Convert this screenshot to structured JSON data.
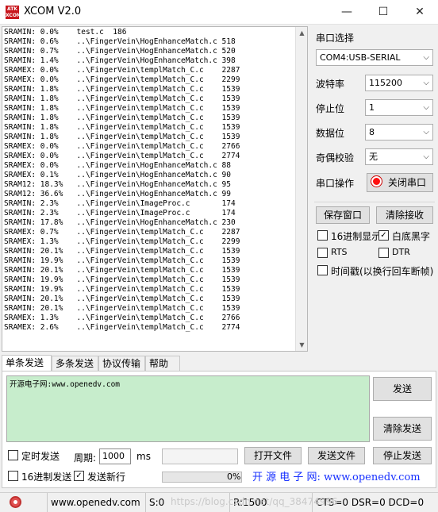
{
  "window": {
    "title": "XCOM V2.0",
    "logo_text": "ATK XCOM",
    "minimize": "—",
    "maximize": "☐",
    "close": "✕"
  },
  "console": {
    "lines": [
      "SRAMIN: 0.0%    test.c  186",
      "SRAMIN: 0.6%    ..\\FingerVein\\HogEnhanceMatch.c 518",
      "SRAMIN: 0.7%    ..\\FingerVein\\HogEnhanceMatch.c 520",
      "SRAMIN: 1.4%    ..\\FingerVein\\HogEnhanceMatch.c 398",
      "SRAMEX: 0.0%    ..\\FingerVein\\templMatch_C.c    2287",
      "SRAMEX: 0.0%    ..\\FingerVein\\templMatch_C.c    2299",
      "SRAMIN: 1.8%    ..\\FingerVein\\templMatch_C.c    1539",
      "SRAMIN: 1.8%    ..\\FingerVein\\templMatch_C.c    1539",
      "SRAMIN: 1.8%    ..\\FingerVein\\templMatch_C.c    1539",
      "SRAMIN: 1.8%    ..\\FingerVein\\templMatch_C.c    1539",
      "SRAMIN: 1.8%    ..\\FingerVein\\templMatch_C.c    1539",
      "SRAMIN: 1.8%    ..\\FingerVein\\templMatch_C.c    1539",
      "SRAMEX: 0.0%    ..\\FingerVein\\templMatch_C.c    2766",
      "SRAMEX: 0.0%    ..\\FingerVein\\templMatch_C.c    2774",
      "SRAMEX: 0.0%    ..\\FingerVein\\HogEnhanceMatch.c 88",
      "SRAMEX: 0.1%    ..\\FingerVein\\HogEnhanceMatch.c 90",
      "SRAM12: 18.3%   ..\\FingerVein\\HogEnhanceMatch.c 95",
      "SRAM12: 36.6%   ..\\FingerVein\\HogEnhanceMatch.c 99",
      "SRAMIN: 2.3%    ..\\FingerVein\\ImageProc.c       174",
      "SRAMIN: 2.3%    ..\\FingerVein\\ImageProc.c       174",
      "SRAMIN: 17.8%   ..\\FingerVein\\HogEnhanceMatch.c 230",
      "SRAMEX: 0.7%    ..\\FingerVein\\templMatch_C.c    2287",
      "SRAMEX: 1.3%    ..\\FingerVein\\templMatch_C.c    2299",
      "SRAMIN: 20.1%   ..\\FingerVein\\templMatch_C.c    1539",
      "SRAMIN: 19.9%   ..\\FingerVein\\templMatch_C.c    1539",
      "SRAMIN: 20.1%   ..\\FingerVein\\templMatch_C.c    1539",
      "SRAMIN: 19.9%   ..\\FingerVein\\templMatch_C.c    1539",
      "SRAMIN: 19.9%   ..\\FingerVein\\templMatch_C.c    1539",
      "SRAMIN: 20.1%   ..\\FingerVein\\templMatch_C.c    1539",
      "SRAMIN: 20.1%   ..\\FingerVein\\templMatch_C.c    1539",
      "SRAMEX: 1.3%    ..\\FingerVein\\templMatch_C.c    2766",
      "SRAMEX: 2.6%    ..\\FingerVein\\templMatch_C.c    2774"
    ],
    "scroll_up": "▲",
    "scroll_down": "▼"
  },
  "settings": {
    "port_label": "串口选择",
    "port_value": "COM4:USB-SERIAL",
    "baud_label": "波特率",
    "baud_value": "115200",
    "stop_label": "停止位",
    "stop_value": "1",
    "data_label": "数据位",
    "data_value": "8",
    "parity_label": "奇偶校验",
    "parity_value": "无",
    "op_label": "串口操作",
    "close_port": "关闭串口",
    "save_window": "保存窗口",
    "clear_receive": "清除接收",
    "hex_display": "16进制显示",
    "white_bg": "白底黑字",
    "rts": "RTS",
    "dtr": "DTR",
    "timestamp": "时间戳(以换行回车断帧)",
    "check_mark": "✓",
    "chevron": "⌵"
  },
  "tabs": [
    "单条发送",
    "多条发送",
    "协议传输",
    "帮助"
  ],
  "send": {
    "text": "开源电子网:www.openedv.com",
    "send_button": "发送",
    "clear_send": "清除发送",
    "timed_send": "定时发送",
    "period_label": "周期:",
    "period_value": "1000",
    "period_unit": "ms",
    "open_file": "打开文件",
    "send_file": "发送文件",
    "stop_send": "停止发送",
    "hex_send": "16进制发送",
    "send_newline": "发送新行",
    "progress_text": "0%",
    "progress": 0,
    "site_watermark": "开 源 电 子 网: www.openedv.com"
  },
  "status": {
    "website": "www.openedv.com",
    "sent": "S:0",
    "received": "R:1500",
    "signals": "CTS=0 DSR=0 DCD=0",
    "overlay": "https://blog.csdn.net/qq_38474996"
  }
}
